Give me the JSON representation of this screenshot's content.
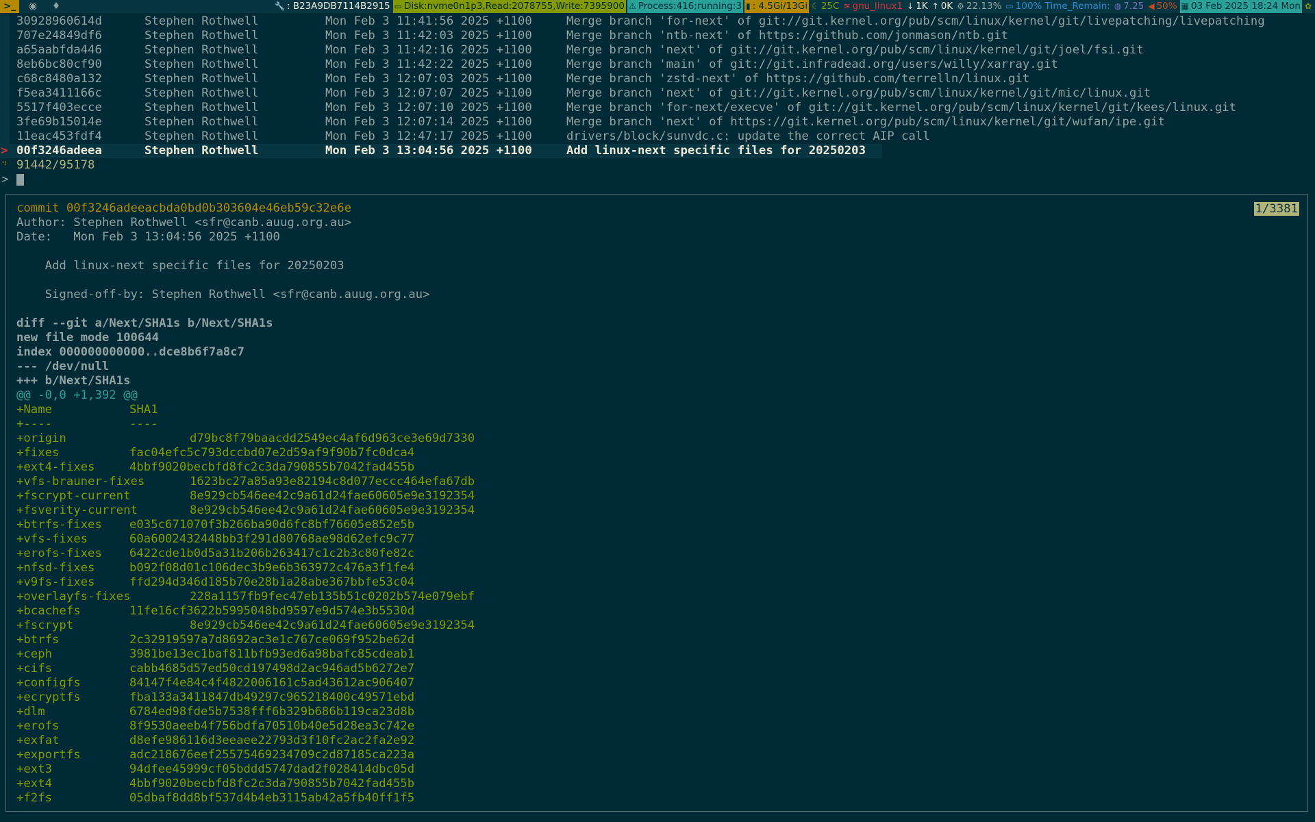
{
  "statusbar": {
    "workspaces": {
      "term": ">_",
      "ws2": "◉",
      "ws3": "♦"
    },
    "items": [
      {
        "icon": "🔧",
        "text": ": B23A9DB7114B2915",
        "bg": "",
        "color": "#eee8d5"
      },
      {
        "icon": "▭",
        "text": "Disk:nvme0n1p3,Read:2078755,Write:7395900",
        "bg": "#859900",
        "color": "#002b36"
      },
      {
        "icon": "⚠",
        "text": "Process:416;running:3",
        "bg": "#2aa198",
        "color": "#002b36"
      },
      {
        "icon": "▮",
        "text": ": 4.5Gi/13Gi",
        "bg": "#b58900",
        "color": "#002b36"
      },
      {
        "icon": "☾",
        "text": "25C",
        "bg": "",
        "color": "#859900"
      },
      {
        "icon": "≋",
        "text": "gnu_linux1",
        "bg": "",
        "color": "#dc322f"
      },
      {
        "icon": "↓",
        "text": "1K",
        "bg": "",
        "color": "#eee8d5"
      },
      {
        "icon": "↑",
        "text": "0K",
        "bg": "",
        "color": "#eee8d5"
      },
      {
        "icon": "⚙",
        "text": "22.13%",
        "bg": "",
        "color": "#93a1a1"
      },
      {
        "icon": "▭",
        "text": "100% Time_Remain:",
        "bg": "",
        "color": "#268bd2"
      },
      {
        "icon": "◍",
        "text": "7.25",
        "bg": "",
        "color": "#6c71c4"
      },
      {
        "icon": "◀",
        "text": "50%",
        "bg": "",
        "color": "#cb4b16"
      },
      {
        "icon": "▦",
        "text": "03 Feb 2025 18:24 Mon",
        "bg": "#2aa198",
        "color": "#002b36"
      },
      {
        "icon": "✿",
        "text": "",
        "bg": "",
        "color": "#859900"
      }
    ]
  },
  "log": [
    {
      "hash": "30928960614d",
      "author": "Stephen Rothwell",
      "date": "Mon Feb 3 11:41:56 2025 +1100",
      "subject": "Merge branch 'for-next' of git://git.kernel.org/pub/scm/linux/kernel/git/livepatching/livepatching"
    },
    {
      "hash": "707e24849df6",
      "author": "Stephen Rothwell",
      "date": "Mon Feb 3 11:42:03 2025 +1100",
      "subject": "Merge branch 'ntb-next' of https://github.com/jonmason/ntb.git"
    },
    {
      "hash": "a65aabfda446",
      "author": "Stephen Rothwell",
      "date": "Mon Feb 3 11:42:16 2025 +1100",
      "subject": "Merge branch 'next' of git://git.kernel.org/pub/scm/linux/kernel/git/joel/fsi.git"
    },
    {
      "hash": "8eb6bc80cf90",
      "author": "Stephen Rothwell",
      "date": "Mon Feb 3 11:42:22 2025 +1100",
      "subject": "Merge branch 'main' of git://git.infradead.org/users/willy/xarray.git"
    },
    {
      "hash": "c68c8480a132",
      "author": "Stephen Rothwell",
      "date": "Mon Feb 3 12:07:03 2025 +1100",
      "subject": "Merge branch 'zstd-next' of https://github.com/terrelln/linux.git"
    },
    {
      "hash": "f5ea3411166c",
      "author": "Stephen Rothwell",
      "date": "Mon Feb 3 12:07:07 2025 +1100",
      "subject": "Merge branch 'next' of git://git.kernel.org/pub/scm/linux/kernel/git/mic/linux.git"
    },
    {
      "hash": "5517f403ecce",
      "author": "Stephen Rothwell",
      "date": "Mon Feb 3 12:07:10 2025 +1100",
      "subject": "Merge branch 'for-next/execve' of git://git.kernel.org/pub/scm/linux/kernel/git/kees/linux.git"
    },
    {
      "hash": "3fe69b15014e",
      "author": "Stephen Rothwell",
      "date": "Mon Feb 3 12:07:14 2025 +1100",
      "subject": "Merge branch 'next' of https://git.kernel.org/pub/scm/linux/kernel/git/wufan/ipe.git"
    },
    {
      "hash": "11eac453fdf4",
      "author": "Stephen Rothwell",
      "date": "Mon Feb 3 12:47:17 2025 +1100",
      "subject": "drivers/block/sunvdc.c: update the correct AIP call"
    },
    {
      "hash": "00f3246adeea",
      "author": "Stephen Rothwell",
      "date": "Mon Feb 3 13:04:56 2025 +1100",
      "subject": "Add linux-next specific files for 20250203"
    }
  ],
  "pointer": ">",
  "counter": "91442/95178",
  "prompt": ">",
  "preview": {
    "position": "1/3381",
    "header": [
      {
        "cls": "commit",
        "text": "commit 00f3246adeeacbda0bd0b303604e46eb59c32e6e"
      },
      {
        "cls": "meta",
        "text": "Author: Stephen Rothwell <sfr@canb.auug.org.au>"
      },
      {
        "cls": "meta",
        "text": "Date:   Mon Feb 3 13:04:56 2025 +1100"
      },
      {
        "cls": "meta",
        "text": ""
      },
      {
        "cls": "meta",
        "text": "    Add linux-next specific files for 20250203"
      },
      {
        "cls": "meta",
        "text": ""
      },
      {
        "cls": "meta",
        "text": "    Signed-off-by: Stephen Rothwell <sfr@canb.auug.org.au>"
      },
      {
        "cls": "meta",
        "text": ""
      },
      {
        "cls": "diffh",
        "text": "diff --git a/Next/SHA1s b/Next/SHA1s"
      },
      {
        "cls": "diffh",
        "text": "new file mode 100644"
      },
      {
        "cls": "diffh",
        "text": "index 000000000000..dce8b6f7a8c7"
      },
      {
        "cls": "diffh",
        "text": "--- /dev/null"
      },
      {
        "cls": "diffh",
        "text": "+++ b/Next/SHA1s"
      },
      {
        "cls": "hunk",
        "text": "@@ -0,0 +1,392 @@"
      }
    ],
    "table": [
      {
        "name": "+Name",
        "sha": "SHA1",
        "wide": false
      },
      {
        "name": "+----",
        "sha": "----",
        "wide": false
      },
      {
        "name": "+origin",
        "sha": "d79bc8f79baacdd2549ec4af6d963ce3e69d7330",
        "wide": true
      },
      {
        "name": "+fixes",
        "sha": "fac04efc5c793dccbd07e2d59af9f90b7fc0dca4",
        "wide": false
      },
      {
        "name": "+ext4-fixes",
        "sha": "4bbf9020becbfd8fc2c3da790855b7042fad455b",
        "wide": false
      },
      {
        "name": "+vfs-brauner-fixes",
        "sha": "1623bc27a85a93e82194c8d077eccc464efa67db",
        "wide": true
      },
      {
        "name": "+fscrypt-current",
        "sha": "8e929cb546ee42c9a61d24fae60605e9e3192354",
        "wide": true
      },
      {
        "name": "+fsverity-current",
        "sha": "8e929cb546ee42c9a61d24fae60605e9e3192354",
        "wide": true
      },
      {
        "name": "+btrfs-fixes",
        "sha": "e035c671070f3b266ba90d6fc8bf76605e852e5b",
        "wide": false
      },
      {
        "name": "+vfs-fixes",
        "sha": "60a6002432448bb3f291d80768ae98d62efc9c77",
        "wide": false
      },
      {
        "name": "+erofs-fixes",
        "sha": "6422cde1b0d5a31b206b263417c1c2b3c80fe82c",
        "wide": false
      },
      {
        "name": "+nfsd-fixes",
        "sha": "b092f08d01c106dec3b9e6b363972c476a3f1fe4",
        "wide": false
      },
      {
        "name": "+v9fs-fixes",
        "sha": "ffd294d346d185b70e28b1a28abe367bbfe53c04",
        "wide": false
      },
      {
        "name": "+overlayfs-fixes",
        "sha": "228a1157fb9fec47eb135b51c0202b574e079ebf",
        "wide": true
      },
      {
        "name": "+bcachefs",
        "sha": "11fe16cf3622b5995048bd9597e9d574e3b5530d",
        "wide": false
      },
      {
        "name": "+fscrypt",
        "sha": "8e929cb546ee42c9a61d24fae60605e9e3192354",
        "wide": true
      },
      {
        "name": "+btrfs",
        "sha": "2c32919597a7d8692ac3e1c767ce069f952be62d",
        "wide": false
      },
      {
        "name": "+ceph",
        "sha": "3981be13ec1baf811bfb93ed6a98bafc85cdeab1",
        "wide": false
      },
      {
        "name": "+cifs",
        "sha": "cabb4685d57ed50cd197498d2ac946ad5b6272e7",
        "wide": false
      },
      {
        "name": "+configfs",
        "sha": "84147f4e84c4f4822006161c5ad43612ac906407",
        "wide": false
      },
      {
        "name": "+ecryptfs",
        "sha": "fba133a3411847db49297c965218400c49571ebd",
        "wide": false
      },
      {
        "name": "+dlm",
        "sha": "6784ed98fde5b7538fff6b329b686b119ca23d8b",
        "wide": false
      },
      {
        "name": "+erofs",
        "sha": "8f9530aeeb4f756bdfa70510b40e5d28ea3c742e",
        "wide": false
      },
      {
        "name": "+exfat",
        "sha": "d8efe986116d3eeaee22793d3f10fc2ac2fa2e92",
        "wide": false
      },
      {
        "name": "+exportfs",
        "sha": "adc218676eef25575469234709c2d87185ca223a",
        "wide": false
      },
      {
        "name": "+ext3",
        "sha": "94dfee45999cf05bddd5747dad2f028414dbc05d",
        "wide": false
      },
      {
        "name": "+ext4",
        "sha": "4bbf9020becbfd8fc2c3da790855b7042fad455b",
        "wide": false
      },
      {
        "name": "+f2fs",
        "sha": "05dbaf8dd8bf537d4b4eb3115ab42a5fb40ff1f5",
        "wide": false
      }
    ]
  }
}
